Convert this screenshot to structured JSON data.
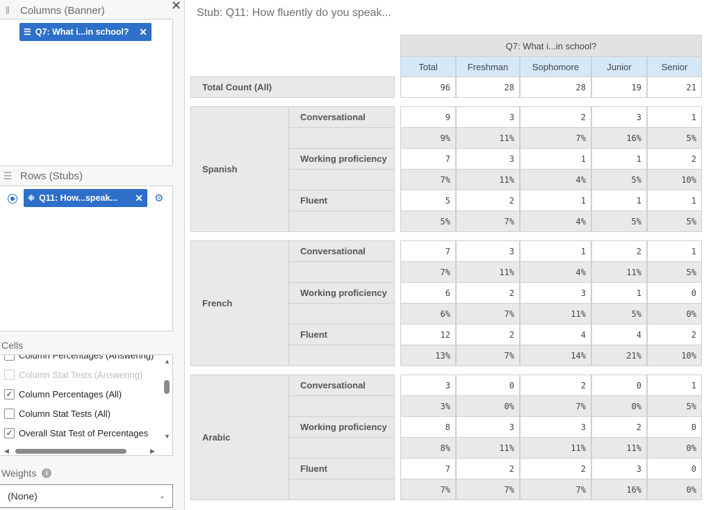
{
  "left": {
    "columns_header": "Columns (Banner)",
    "columns_chip": "Q7: What i...in school?",
    "rows_header": "Rows (Stubs)",
    "rows_chip": "Q11: How...speak...",
    "cells_header": "Cells",
    "cell_options": [
      {
        "label": "Column Percentages (Answering)",
        "checked": false,
        "enabled": true
      },
      {
        "label": "Column Stat Tests (Answering)",
        "checked": false,
        "enabled": false
      },
      {
        "label": "Column Percentages (All)",
        "checked": true,
        "enabled": true
      },
      {
        "label": "Column Stat Tests (All)",
        "checked": false,
        "enabled": true
      },
      {
        "label": "Overall Stat Test of Percentages",
        "checked": true,
        "enabled": true
      }
    ],
    "weights_header": "Weights",
    "weights_value": "(None)"
  },
  "main": {
    "stub_title": "Stub: Q11: How fluently do you speak...",
    "banner_title": "Q7: What i...in school?",
    "columns": [
      "Total",
      "Freshman",
      "Sophomore",
      "Junior",
      "Senior"
    ],
    "total_row": {
      "label": "Total Count (All)",
      "values": [
        "96",
        "28",
        "28",
        "19",
        "21"
      ]
    },
    "groups": [
      {
        "name": "Spanish",
        "rows": [
          {
            "label": "Conversational",
            "count": [
              "9",
              "3",
              "2",
              "3",
              "1"
            ],
            "pct": [
              "9%",
              "11%",
              "7%",
              "16%",
              "5%"
            ]
          },
          {
            "label": "Working proficiency",
            "count": [
              "7",
              "3",
              "1",
              "1",
              "2"
            ],
            "pct": [
              "7%",
              "11%",
              "4%",
              "5%",
              "10%"
            ]
          },
          {
            "label": "Fluent",
            "count": [
              "5",
              "2",
              "1",
              "1",
              "1"
            ],
            "pct": [
              "5%",
              "7%",
              "4%",
              "5%",
              "5%"
            ]
          }
        ]
      },
      {
        "name": "French",
        "rows": [
          {
            "label": "Conversational",
            "count": [
              "7",
              "3",
              "1",
              "2",
              "1"
            ],
            "pct": [
              "7%",
              "11%",
              "4%",
              "11%",
              "5%"
            ]
          },
          {
            "label": "Working proficiency",
            "count": [
              "6",
              "2",
              "3",
              "1",
              "0"
            ],
            "pct": [
              "6%",
              "7%",
              "11%",
              "5%",
              "0%"
            ]
          },
          {
            "label": "Fluent",
            "count": [
              "12",
              "2",
              "4",
              "4",
              "2"
            ],
            "pct": [
              "13%",
              "7%",
              "14%",
              "21%",
              "10%"
            ]
          }
        ]
      },
      {
        "name": "Arabic",
        "rows": [
          {
            "label": "Conversational",
            "count": [
              "3",
              "0",
              "2",
              "0",
              "1"
            ],
            "pct": [
              "3%",
              "0%",
              "7%",
              "0%",
              "5%"
            ]
          },
          {
            "label": "Working proficiency",
            "count": [
              "8",
              "3",
              "3",
              "2",
              "0"
            ],
            "pct": [
              "8%",
              "11%",
              "11%",
              "11%",
              "0%"
            ]
          },
          {
            "label": "Fluent",
            "count": [
              "7",
              "2",
              "2",
              "3",
              "0"
            ],
            "pct": [
              "7%",
              "7%",
              "7%",
              "16%",
              "0%"
            ]
          }
        ]
      }
    ]
  }
}
